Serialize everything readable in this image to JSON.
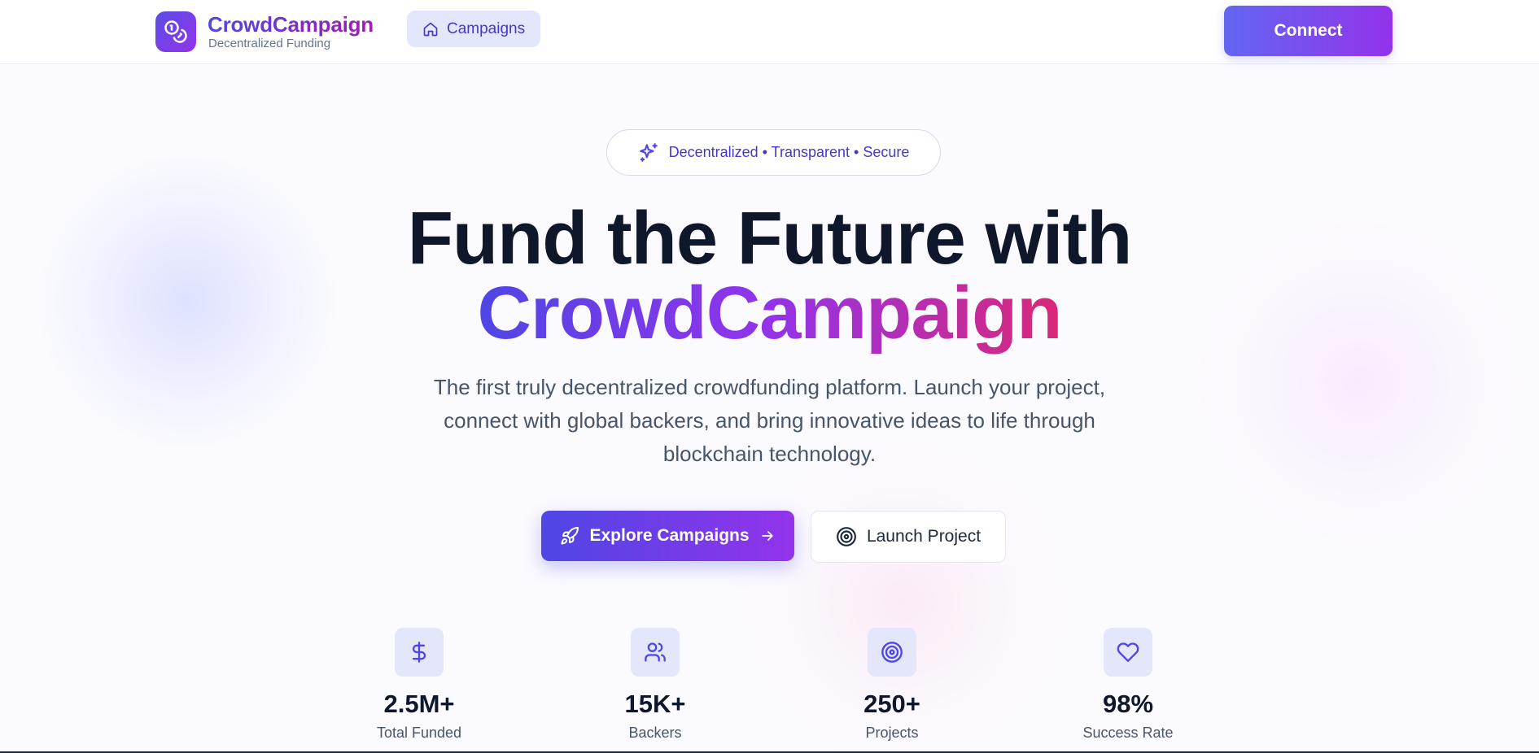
{
  "header": {
    "brand_title": "CrowdCampaign",
    "brand_subtitle": "Decentralized Funding",
    "nav_campaigns": "Campaigns",
    "connect_label": "Connect"
  },
  "hero": {
    "badge": "Decentralized • Transparent • Secure",
    "title_line1": "Fund the Future with",
    "title_line2": "CrowdCampaign",
    "description": "The first truly decentralized crowdfunding platform. Launch your project, connect with global backers, and bring innovative ideas to life through blockchain technology.",
    "explore_label": "Explore Campaigns",
    "launch_label": "Launch Project"
  },
  "stats": [
    {
      "icon": "dollar-icon",
      "value": "2.5M+",
      "label": "Total Funded"
    },
    {
      "icon": "users-icon",
      "value": "15K+",
      "label": "Backers"
    },
    {
      "icon": "target-icon",
      "value": "250+",
      "label": "Projects"
    },
    {
      "icon": "heart-icon",
      "value": "98%",
      "label": "Success Rate"
    }
  ],
  "colors": {
    "primary": "#4f46e5",
    "secondary": "#9333ea",
    "accent_pink": "#db2777",
    "text_dark": "#0f172a",
    "text_muted": "#475569"
  }
}
